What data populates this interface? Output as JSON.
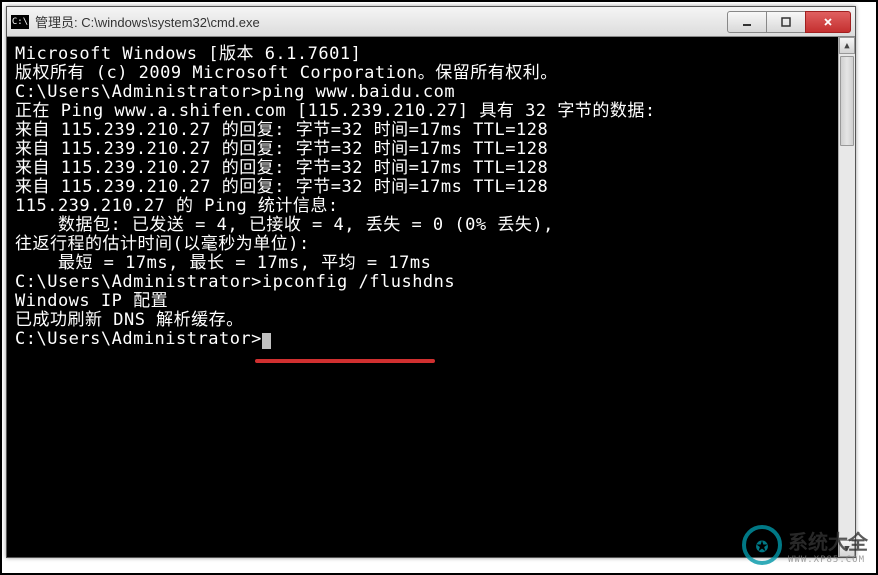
{
  "window": {
    "icon_label": "C:\\",
    "title": "管理员: C:\\windows\\system32\\cmd.exe"
  },
  "terminal": {
    "lines": [
      "Microsoft Windows [版本 6.1.7601]",
      "版权所有 (c) 2009 Microsoft Corporation。保留所有权利。",
      "",
      "C:\\Users\\Administrator>ping www.baidu.com",
      "",
      "正在 Ping www.a.shifen.com [115.239.210.27] 具有 32 字节的数据:",
      "来自 115.239.210.27 的回复: 字节=32 时间=17ms TTL=128",
      "来自 115.239.210.27 的回复: 字节=32 时间=17ms TTL=128",
      "来自 115.239.210.27 的回复: 字节=32 时间=17ms TTL=128",
      "来自 115.239.210.27 的回复: 字节=32 时间=17ms TTL=128",
      "",
      "115.239.210.27 的 Ping 统计信息:",
      "    数据包: 已发送 = 4, 已接收 = 4, 丢失 = 0 (0% 丢失),",
      "往返行程的估计时间(以毫秒为单位):",
      "    最短 = 17ms, 最长 = 17ms, 平均 = 17ms",
      "",
      "C:\\Users\\Administrator>ipconfig /flushdns",
      "",
      "Windows IP 配置",
      "",
      "已成功刷新 DNS 解析缓存。",
      "",
      "C:\\Users\\Administrator>"
    ]
  },
  "annotation": {
    "underline_text": "ipconfig /flushdns",
    "color": "#d03030"
  },
  "watermark": {
    "brand": "系统大全",
    "url": "WWW.XP85.COM"
  }
}
